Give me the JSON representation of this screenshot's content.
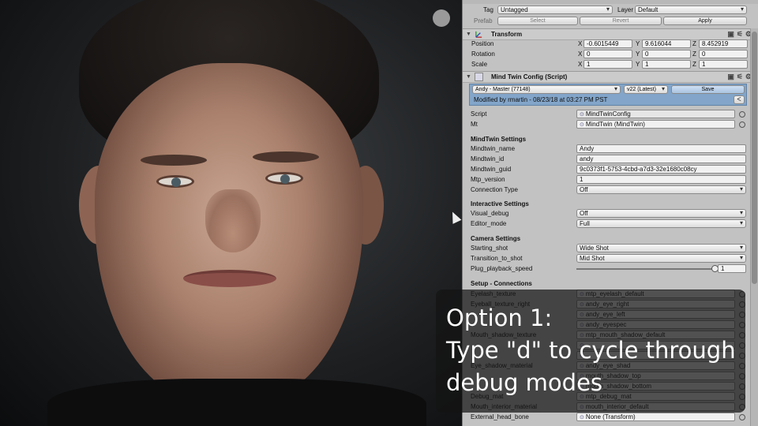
{
  "inspector": {
    "top": {
      "tag_label": "Tag",
      "tag_value": "Untagged",
      "layer_label": "Layer",
      "layer_value": "Default",
      "prefab_label": "Prefab",
      "select_label": "Select",
      "revert_label": "Revert",
      "apply_label": "Apply"
    },
    "transform": {
      "title": "Transform",
      "position_label": "Position",
      "rotation_label": "Rotation",
      "scale_label": "Scale",
      "axis_x": "X",
      "axis_y": "Y",
      "axis_z": "Z",
      "position": {
        "x": "-0.6015449",
        "y": "9.616044",
        "z": "8.452919"
      },
      "rotation": {
        "x": "0",
        "y": "0",
        "z": "0"
      },
      "scale": {
        "x": "1",
        "y": "1",
        "z": "1"
      }
    },
    "mind_twin_config": {
      "title": "Mind Twin Config (Script)",
      "branch": "Andy - Master (77148)",
      "version": "v22 (Latest)",
      "save_label": "Save",
      "modified_text": "Modified by rmartin - 08/23/18 at 03:27 PM PST",
      "script_label": "Script",
      "script_value": "MindTwinConfig",
      "mt_label": "Mt",
      "mt_value": "MindTwin (MindTwin)",
      "mindtwin_settings_header": "MindTwin Settings",
      "mindtwin_name_label": "Mindtwin_name",
      "mindtwin_name_value": "Andy",
      "mindtwin_id_label": "Mindtwin_id",
      "mindtwin_id_value": "andy",
      "mindtwin_guid_label": "Mindtwin_guid",
      "mindtwin_guid_value": "9c0373f1-5753-4cbd-a7d3-32e1680c08cy",
      "mtp_version_label": "Mtp_version",
      "mtp_version_value": "1",
      "connection_type_label": "Connection Type",
      "connection_type_value": "Off",
      "interactive_settings_header": "Interactive Settings",
      "visual_debug_label": "Visual_debug",
      "visual_debug_value": "Off",
      "editor_mode_label": "Editor_mode",
      "editor_mode_value": "Full",
      "camera_settings_header": "Camera Settings",
      "starting_shot_label": "Starting_shot",
      "starting_shot_value": "Wide Shot",
      "transition_to_shot_label": "Transition_to_shot",
      "transition_to_shot_value": "Mid Shot",
      "plug_playback_speed_label": "Plug_playback_speed",
      "plug_playback_speed_value": "1",
      "plug_playback_speed_fraction": 1.0,
      "setup_connections_header": "Setup - Connections",
      "connections": [
        {
          "label": "Eyelash_texture",
          "value": "mtp_eyelash_default"
        },
        {
          "label": "Eyeball_texture_right",
          "value": "andy_eye_right"
        },
        {
          "label": "",
          "value": "andy_eye_left"
        },
        {
          "label": "",
          "value": "andy_eyespec"
        },
        {
          "label": "Mouth_shadow_texture",
          "value": "mtp_mouth_shadow_default"
        },
        {
          "label": "",
          "value": ""
        },
        {
          "label": "",
          "value": ""
        },
        {
          "label": "Eye_shadow_material",
          "value": "andy_eye_shad"
        },
        {
          "label": "",
          "value": "mouth_shadow_top"
        },
        {
          "label": "",
          "value": "mouth_shadow_bottom"
        },
        {
          "label": "Debug_mat",
          "value": "mtp_debug_mat"
        },
        {
          "label": "Mouth_interior_material",
          "value": "mouth_interior_default"
        },
        {
          "label": "External_head_bone",
          "value": "None (Transform)"
        }
      ]
    }
  },
  "caption": {
    "line1": "Option 1:",
    "line2": "Type \"d\" to cycle through",
    "line3": "debug modes"
  }
}
